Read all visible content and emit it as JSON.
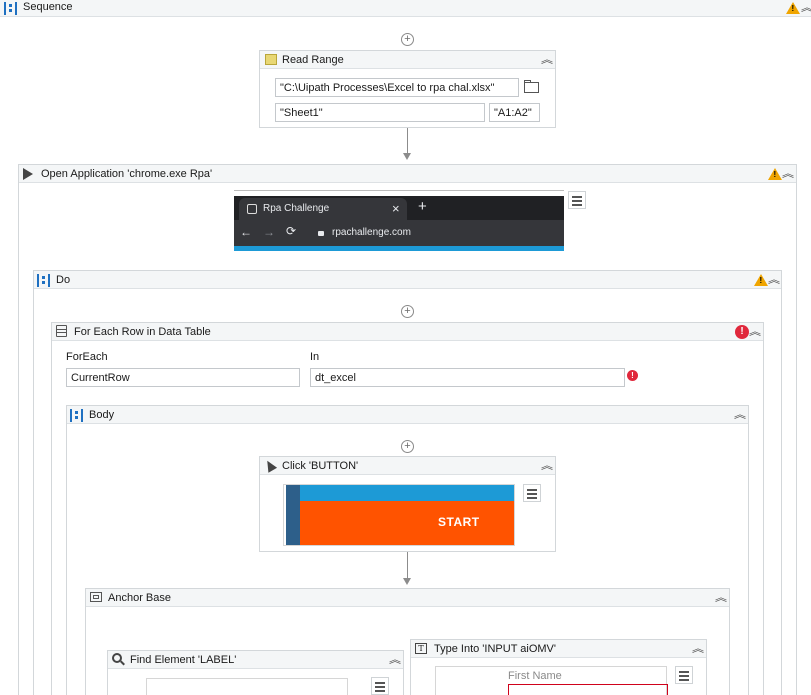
{
  "sequence": {
    "title": "Sequence"
  },
  "read_range": {
    "title": "Read Range",
    "workbook_path": "\"C:\\Uipath Processes\\Excel to rpa chal.xlsx\"",
    "sheet": "\"Sheet1\"",
    "range": "\"A1:A2\""
  },
  "open_application": {
    "title": "Open Application 'chrome.exe Rpa'",
    "browser": {
      "tab_title": "Rpa Challenge",
      "close_glyph": "×",
      "new_tab_glyph": "+",
      "back_glyph": "←",
      "forward_glyph": "→",
      "reload_glyph": "⟳",
      "url": "rpachallenge.com"
    }
  },
  "do": {
    "title": "Do"
  },
  "for_each": {
    "title": "For Each Row in Data Table",
    "foreach_label": "ForEach",
    "foreach_value": "CurrentRow",
    "in_label": "In",
    "in_value": "dt_excel"
  },
  "body": {
    "title": "Body"
  },
  "click": {
    "title": "Click 'BUTTON'",
    "button_text": "START"
  },
  "anchor_base": {
    "title": "Anchor Base"
  },
  "find_element": {
    "title": "Find Element 'LABEL'"
  },
  "type_into": {
    "title": "Type Into 'INPUT  aiOMV'",
    "preview_label": "First Name"
  },
  "glyphs": {
    "collapse": "︽",
    "plus": "+",
    "error": "!"
  },
  "colors": {
    "accent": "#1f70c1",
    "warning": "#f0a500",
    "error": "#e0283c",
    "start_button": "#ff5300",
    "browser_dark": "#202124"
  }
}
